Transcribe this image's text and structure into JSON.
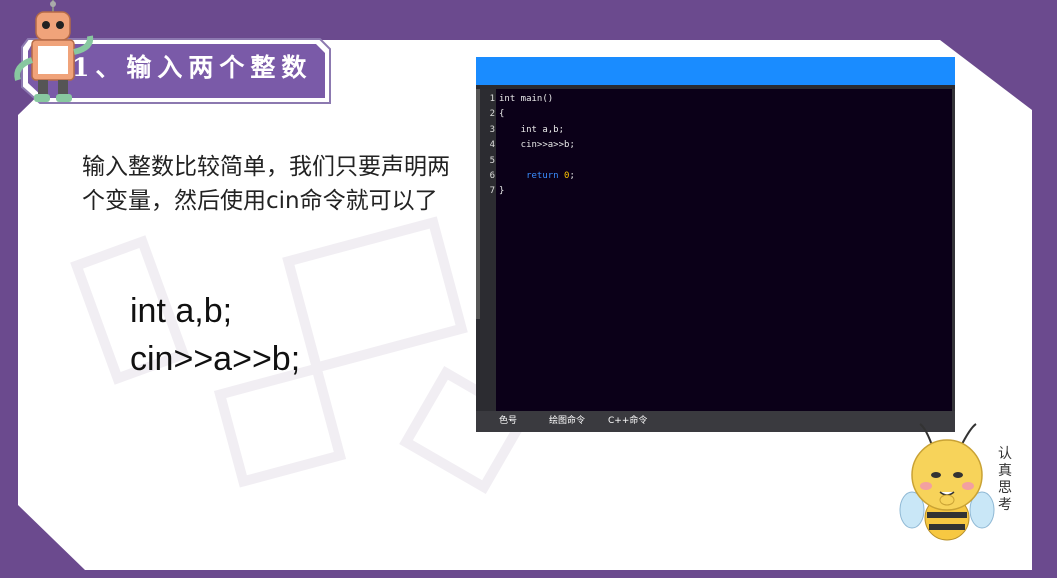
{
  "title": "1、输入两个整数",
  "description": "输入整数比较简单，我们只要声明两个变量，然后使用cin命令就可以了",
  "code_big": [
    "int a,b;",
    "cin>>a>>b;"
  ],
  "editor": {
    "line_numbers": [
      "1",
      "2",
      "3",
      "4",
      "5",
      "6",
      "7"
    ],
    "lines": [
      "int main()",
      "{",
      "    int a,b;",
      "    cin>>a>>b;",
      "",
      "",
      "}"
    ],
    "line6": {
      "indent": "     ",
      "keyword": "return",
      "value": "0",
      "tail": ";"
    },
    "footer_tabs": [
      "色号",
      "绘图命令",
      "C++命令"
    ]
  },
  "mascot_text": [
    "认",
    "真",
    "思",
    "考"
  ],
  "colors": {
    "background": "#6b4a8e",
    "slide": "#ffffff",
    "banner": "#7a5aa8",
    "editor_titlebar": "#1a8cff",
    "editor_body": "#0b0018",
    "keyword_return": "#3a8dff",
    "keyword_number": "#ffc400"
  }
}
